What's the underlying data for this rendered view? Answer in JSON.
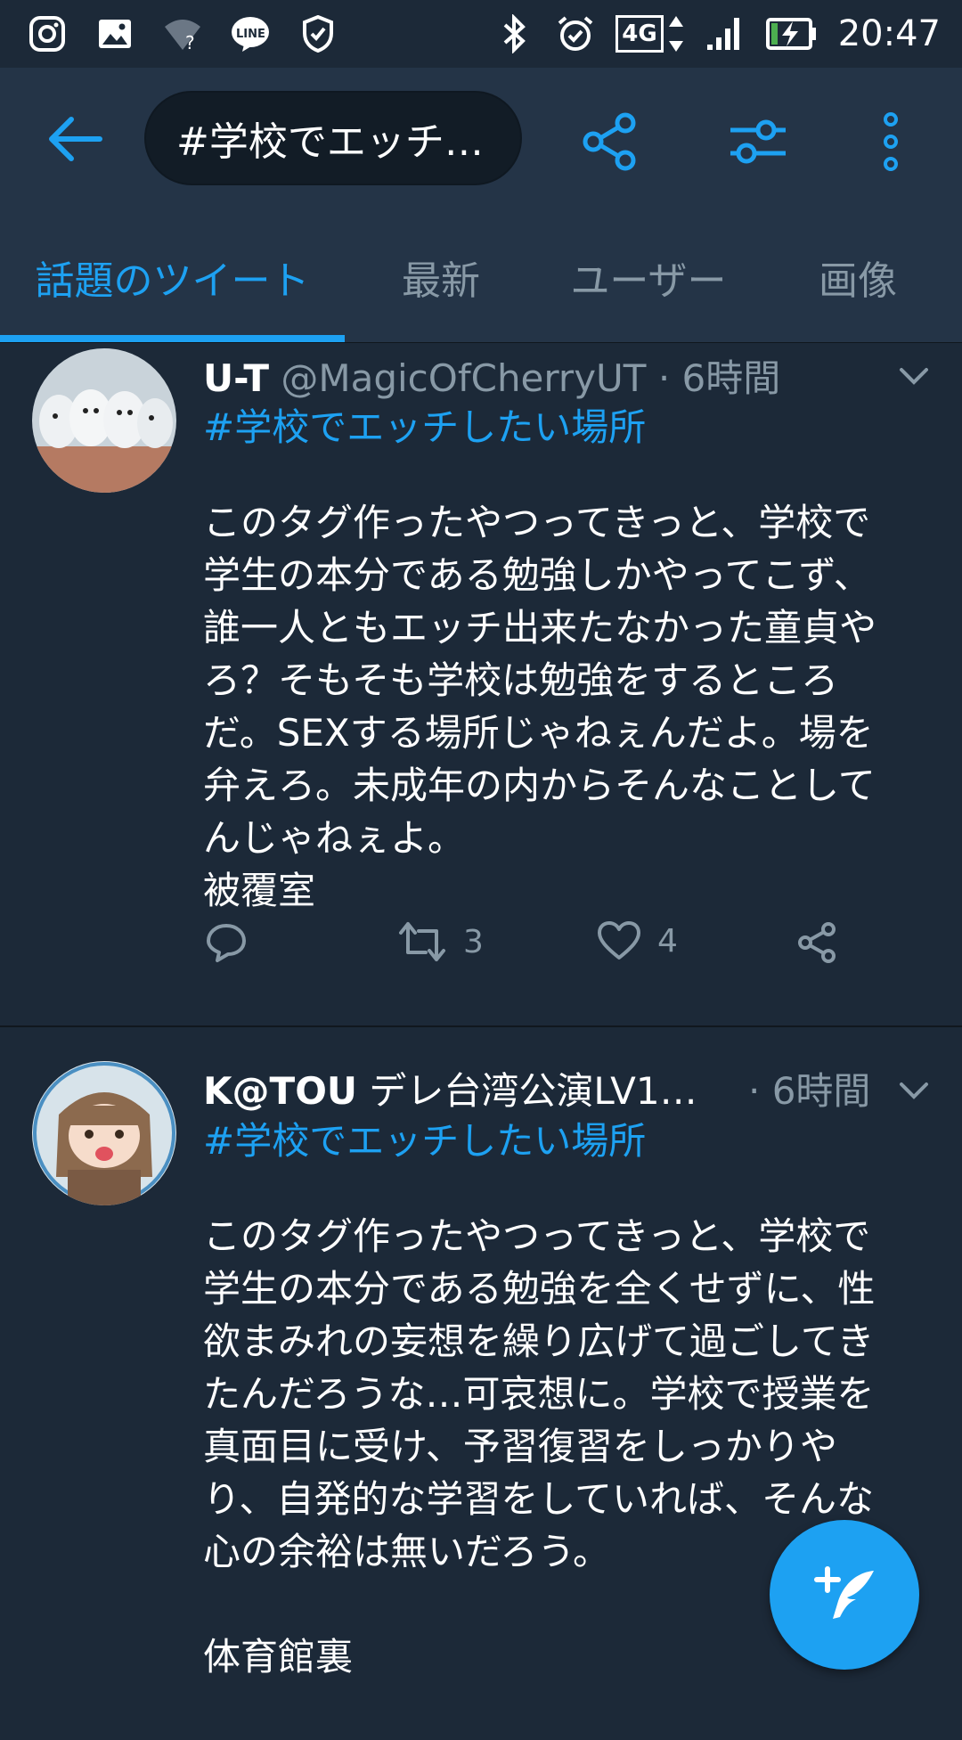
{
  "status_bar": {
    "left_icons": [
      "instagram-icon",
      "image-icon",
      "wifi-unknown-icon",
      "line-icon",
      "shield-check-icon"
    ],
    "network": "4G",
    "time": "20:47"
  },
  "app_bar": {
    "search_text": "#学校でエッチ…",
    "icons": [
      "back-arrow-icon",
      "share-icon",
      "filter-sliders-icon",
      "more-vertical-icon"
    ],
    "accent_color": "#1da1f2"
  },
  "tabs": [
    {
      "label": "話題のツイート",
      "active": true
    },
    {
      "label": "最新",
      "active": false
    },
    {
      "label": "ユーザー",
      "active": false
    },
    {
      "label": "画像",
      "active": false
    }
  ],
  "tweets": [
    {
      "name": "U-T",
      "handle": "@MagicOfCherryUT",
      "time": "· 6時間",
      "hashtag": "#学校でエッチしたい場所",
      "body": "このタグ作ったやつってきっと、学校で\n学生の本分である勉強しかやってこず、\n誰一人ともエッチ出来たなかった童貞や\nろ？そもそも学校は勉強をするところ\nだ。SEXする場所じゃねぇんだよ。場を\n弁えろ。未成年の内からそんなことして\nんじゃねぇよ。\n被覆室",
      "retweets": "3",
      "likes": "4"
    },
    {
      "name": "K@TOU",
      "handle": "デレ台湾公演LV1…",
      "time": "· 6時間",
      "hashtag": "#学校でエッチしたい場所",
      "body": "このタグ作ったやつってきっと、学校で\n学生の本分である勉強を全くせずに、性\n欲まみれの妄想を繰り広げて過ごしてき\nたんだろうな…可哀想に。学校で授業を\n真面目に受け、予習復習をしっかりや\nり、自発的な学習をしていれば、そんな\n心の余裕は無いだろう。\n\n体育館裏"
    }
  ],
  "fab": {
    "icon": "compose-tweet-icon",
    "color": "#1da1f2"
  }
}
